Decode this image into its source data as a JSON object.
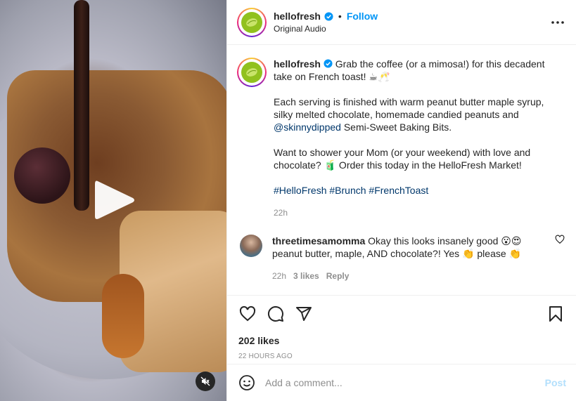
{
  "header": {
    "username": "hellofresh",
    "separator": "•",
    "follow_label": "Follow",
    "audio": "Original Audio"
  },
  "caption": {
    "username": "hellofresh",
    "line1": "Grab the coffee (or a mimosa!) for this decadent take on French toast! ☕🥂",
    "p2_a": "Each serving is finished with warm peanut butter maple syrup, silky melted chocolate, homemade candied peanuts and ",
    "p2_mention": "@skinnydipped",
    "p2_b": " Semi-Sweet Baking Bits.",
    "p3": "Want to shower your Mom (or your weekend) with love and chocolate? 🧃 Order this today in the HelloFresh Market!",
    "hashtags": [
      "#HelloFresh",
      "#Brunch",
      "#FrenchToast"
    ],
    "time": "22h"
  },
  "comment": {
    "username": "threetimesamomma",
    "text": "Okay this looks insanely good 😮😍 peanut butter, maple, AND chocolate?! Yes 👏 please 👏",
    "time": "22h",
    "likes": "3 likes",
    "reply": "Reply"
  },
  "footer": {
    "likes": "202 likes",
    "timestamp": "22 HOURS AGO",
    "comment_placeholder": "Add a comment...",
    "post_label": "Post"
  },
  "colors": {
    "accent": "#0095f6",
    "hashtag": "#00376b",
    "muted": "#8e8e8e",
    "brand_lime": "#91c11e"
  },
  "icons": [
    "play-icon",
    "mute-icon",
    "verified-icon",
    "more-icon",
    "heart-icon",
    "comment-icon",
    "share-icon",
    "bookmark-icon",
    "emoji-icon"
  ]
}
